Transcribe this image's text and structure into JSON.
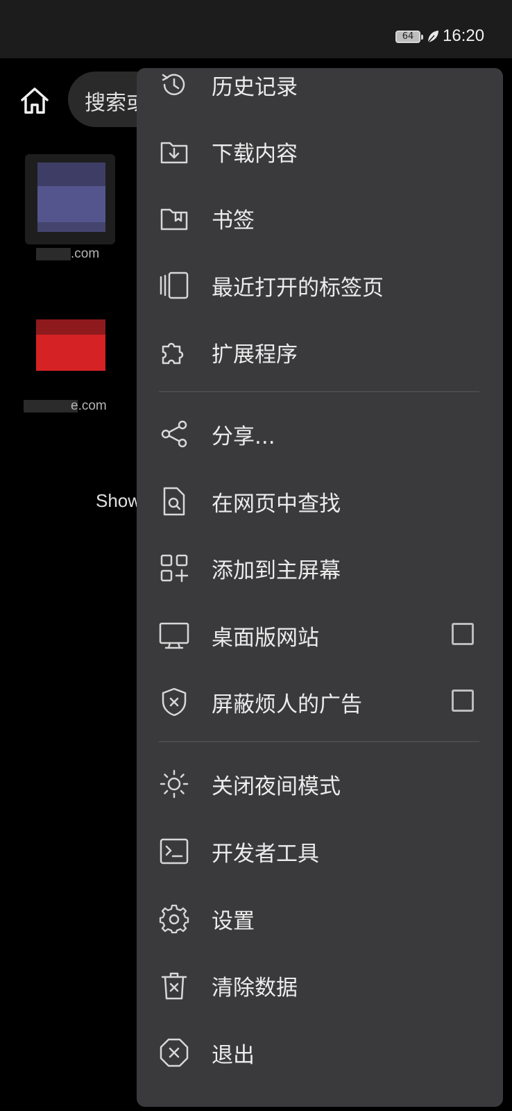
{
  "status_bar": {
    "battery_level": "64",
    "time": "16:20"
  },
  "browser": {
    "search_placeholder": "搜索或",
    "tiles": [
      {
        "label": ".com"
      },
      {
        "label": "e.com"
      }
    ],
    "show_text": "Show"
  },
  "menu": {
    "items": [
      {
        "label": "历史记录",
        "icon": "history-icon"
      },
      {
        "label": "下载内容",
        "icon": "download-folder-icon"
      },
      {
        "label": "书签",
        "icon": "bookmark-folder-icon"
      },
      {
        "label": "最近打开的标签页",
        "icon": "recent-tabs-icon"
      },
      {
        "label": "扩展程序",
        "icon": "puzzle-icon"
      },
      {
        "label": "分享...",
        "icon": "share-icon"
      },
      {
        "label": "在网页中查找",
        "icon": "find-in-page-icon"
      },
      {
        "label": "添加到主屏幕",
        "icon": "add-to-home-icon"
      },
      {
        "label": "桌面版网站",
        "icon": "desktop-icon",
        "checked": false
      },
      {
        "label": "屏蔽烦人的广告",
        "icon": "shield-x-icon",
        "checked": false
      },
      {
        "label": "关闭夜间模式",
        "icon": "sun-icon"
      },
      {
        "label": "开发者工具",
        "icon": "terminal-icon"
      },
      {
        "label": "设置",
        "icon": "gear-icon"
      },
      {
        "label": "清除数据",
        "icon": "trash-icon"
      },
      {
        "label": "退出",
        "icon": "exit-icon"
      }
    ]
  }
}
